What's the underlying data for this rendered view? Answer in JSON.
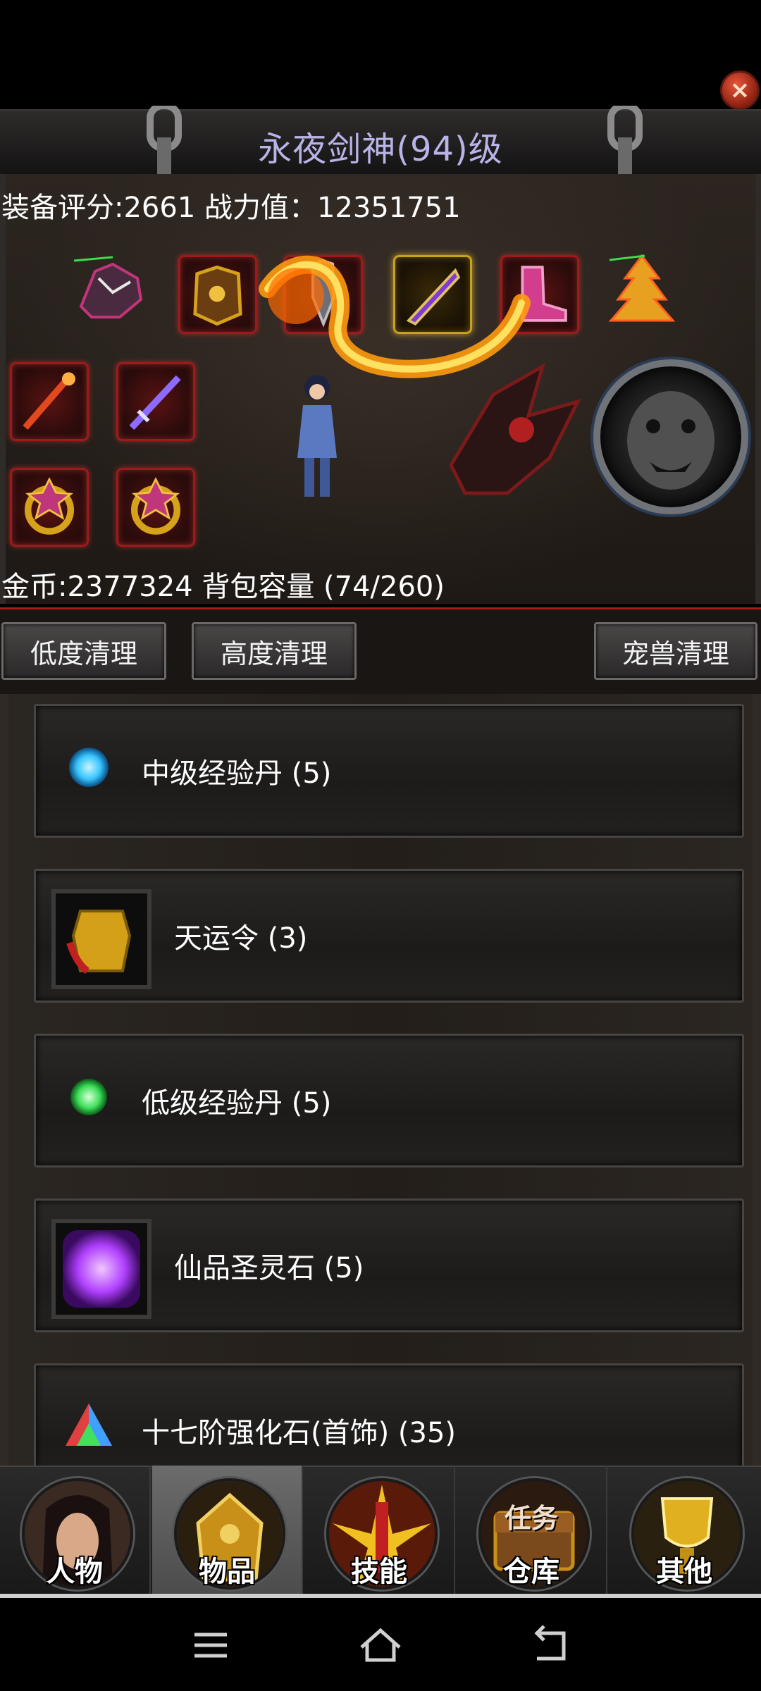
{
  "window": {
    "title": "永夜剑神(94)级",
    "close_icon": "close-icon"
  },
  "stats": {
    "text": "装备评分:2661 战力值：12351751",
    "gold_text": "金币:2377324 背包容量 (74/260)"
  },
  "equipment": {
    "slots": [
      {
        "name": "helmet-icon",
        "color": "#c0367a"
      },
      {
        "name": "armor-icon",
        "color": "#d6a21c"
      },
      {
        "name": "weapon-icon",
        "color": "#9a9a9a"
      },
      {
        "name": "blade-icon",
        "color": "#7e3bd6"
      },
      {
        "name": "boots-icon",
        "color": "#d23d8e"
      },
      {
        "name": "pagoda-icon",
        "color": "#e8a021"
      },
      {
        "name": "staff-icon",
        "color": "#e24a1e"
      },
      {
        "name": "sword-icon",
        "color": "#8d6bff"
      },
      {
        "name": "ring-icon",
        "color": "#d6a21c"
      },
      {
        "name": "ring-icon",
        "color": "#d6a21c"
      }
    ],
    "pet_icon": "tiger-icon",
    "mount_icon": "dragon-icon",
    "character_icon": "hero-icon"
  },
  "cleanup": {
    "low_label": "低度清理",
    "high_label": "高度清理",
    "pet_label": "宠兽清理"
  },
  "items": [
    {
      "label": "中级经验丹 (5)",
      "icon": "blue-pill-icon",
      "color": "#36c5ff"
    },
    {
      "label": "天运令 (3)",
      "icon": "token-icon",
      "color": "#d4a017"
    },
    {
      "label": "低级经验丹 (5)",
      "icon": "green-pill-icon",
      "color": "#3ee05a"
    },
    {
      "label": "仙品圣灵石 (5)",
      "icon": "purple-stone-icon",
      "color": "#b040ff"
    },
    {
      "label": "十七阶强化石(首饰) (35)",
      "icon": "rainbow-gem-icon",
      "color": "#e04040"
    }
  ],
  "nav": {
    "tabs": [
      {
        "label": "人物",
        "icon": "character-icon"
      },
      {
        "label": "物品",
        "icon": "items-icon"
      },
      {
        "label": "技能",
        "icon": "skills-icon"
      },
      {
        "label": "仓库",
        "icon": "storage-icon",
        "icon_text": "任务"
      },
      {
        "label": "其他",
        "icon": "trophy-icon"
      }
    ],
    "active": "物品"
  },
  "system_bar": {
    "buttons": [
      "menu-icon",
      "home-icon",
      "back-icon"
    ]
  }
}
